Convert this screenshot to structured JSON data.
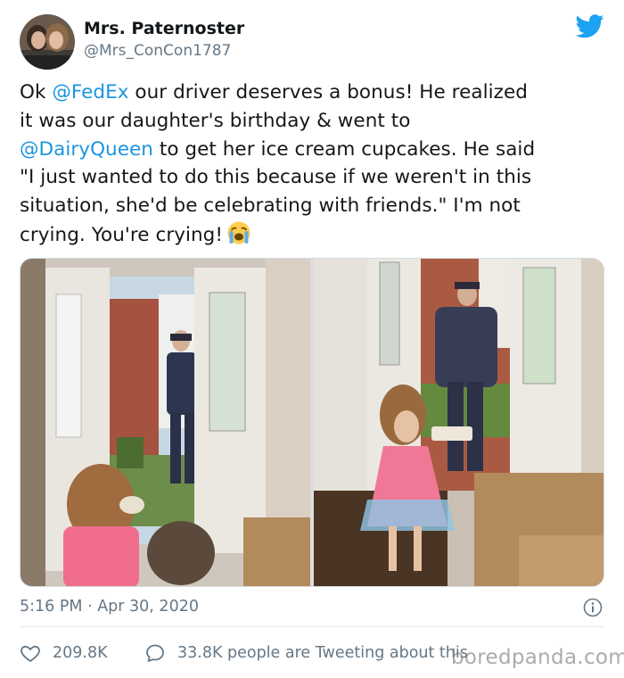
{
  "user": {
    "display_name": "Mrs. Paternoster",
    "handle": "@Mrs_ConCon1787"
  },
  "icons": {
    "brand": "twitter-bird-icon",
    "emoji": "loudly-crying-face-emoji",
    "info": "info-icon",
    "like": "heart-icon",
    "reply": "speech-bubble-icon"
  },
  "colors": {
    "link": "#1b95e0",
    "twitter_blue": "#1da1f2",
    "secondary_text": "#657786"
  },
  "tweet": {
    "line1": {
      "pre": "Ok ",
      "mention": "@FedEx",
      "post": " our driver deserves a bonus!  He realized"
    },
    "line2": "it was our daughter's birthday & went to",
    "line3": {
      "mention": "@DairyQueen",
      "post": " to get her ice cream cupcakes. He said"
    },
    "line4": "\"I just wanted to do this because if we weren't in this",
    "line5": "situation, she'd be celebrating with friends.\" I'm not",
    "line6": "crying. You're crying!"
  },
  "timestamp": "5:16 PM · Apr 30, 2020",
  "stats": {
    "likes": "209.8K",
    "tweeting": "33.8K people are Tweeting about this"
  },
  "watermark": "boredpanda.com"
}
